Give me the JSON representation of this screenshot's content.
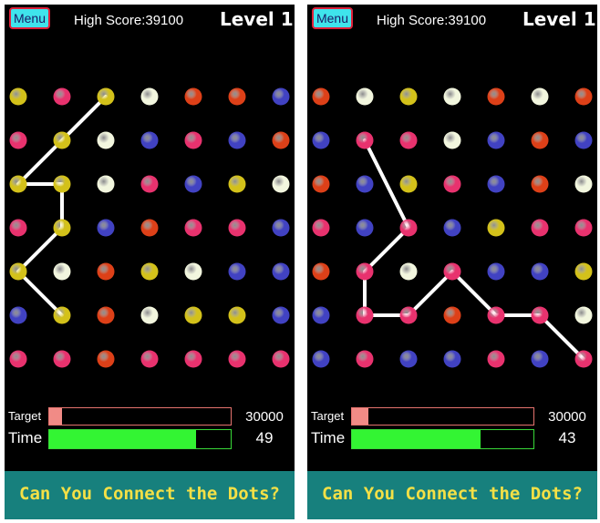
{
  "colors": {
    "Y": "#d3c11a",
    "P": "#e8326e",
    "W": "#f2f6de",
    "O": "#dd4018",
    "B": "#4142c2",
    "line": "#ffffff",
    "banner": "#17807d",
    "banner_text": "#f4e046",
    "target_fill": "#f18b86",
    "time_fill": "#33f533"
  },
  "screens": [
    {
      "menu_label": "Menu",
      "high_score": "High Score:39100",
      "level": "Level 1",
      "grid": [
        "YPYWOOB",
        "PYWBPBO",
        "YYWPBYW",
        "PYBOPPB",
        "YWOYWBB",
        "BYOWYYB",
        "PPOPPPP"
      ],
      "path": [
        [
          0,
          2
        ],
        [
          1,
          1
        ],
        [
          2,
          0
        ],
        [
          2,
          1
        ],
        [
          3,
          1
        ],
        [
          4,
          0
        ],
        [
          5,
          1
        ]
      ],
      "target_label": "Target",
      "target_value": "30000",
      "target_progress": 0.07,
      "time_label": "Time",
      "time_value": "49",
      "time_progress": 0.81,
      "banner": "Can You Connect the Dots?"
    },
    {
      "menu_label": "Menu",
      "high_score": "High Score:39100",
      "level": "Level 1",
      "grid": [
        "OWYWOWO",
        "BPPWBOB",
        "OBYPBOW",
        "PBPBYPP",
        "OPWPBBY",
        "BPPOPPW",
        "BPBBPBP"
      ],
      "path": [
        [
          1,
          1
        ],
        [
          3,
          2
        ],
        [
          4,
          1
        ],
        [
          5,
          1
        ],
        [
          5,
          2
        ],
        [
          4,
          3
        ],
        [
          5,
          4
        ],
        [
          5,
          5
        ],
        [
          6,
          6
        ]
      ],
      "target_label": "Target",
      "target_value": "30000",
      "target_progress": 0.09,
      "time_label": "Time",
      "time_value": "43",
      "time_progress": 0.71,
      "banner": "Can You Connect the Dots?"
    }
  ]
}
